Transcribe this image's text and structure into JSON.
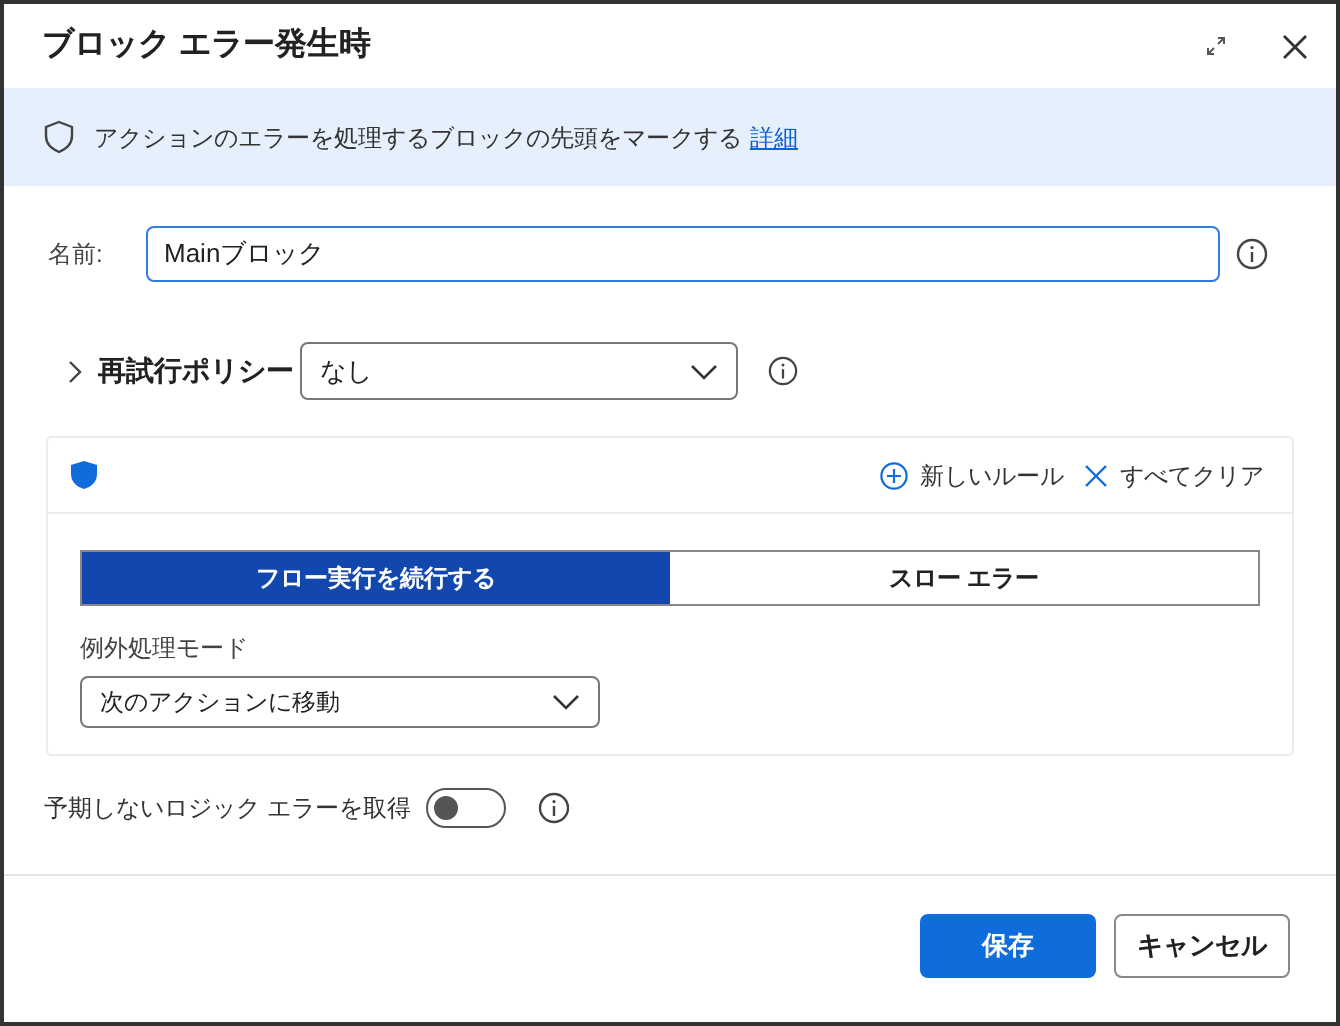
{
  "window": {
    "title": "ブロック エラー発生時"
  },
  "banner": {
    "text": "アクションのエラーを処理するブロックの先頭をマークする",
    "link": "詳細"
  },
  "name_field": {
    "label": "名前:",
    "value": "Mainブロック"
  },
  "retry_policy": {
    "label": "再試行ポリシー",
    "expanded": false,
    "value": "なし"
  },
  "rules": {
    "actions": [
      {
        "kind": "add",
        "label": "新しいルール"
      },
      {
        "kind": "clear",
        "label": "すべてクリア"
      }
    ],
    "tabs": [
      {
        "label": "フロー実行を続行する",
        "selected": true
      },
      {
        "label": "スロー エラー",
        "selected": false
      }
    ],
    "mode_label": "例外処理モード",
    "mode_value": "次のアクションに移動"
  },
  "logic_errors": {
    "label": "予期しないロジック エラーを取得",
    "on": false
  },
  "buttons": [
    {
      "kind": "primary",
      "label": "保存"
    },
    {
      "kind": "secondary",
      "label": "キャンセル"
    }
  ]
}
